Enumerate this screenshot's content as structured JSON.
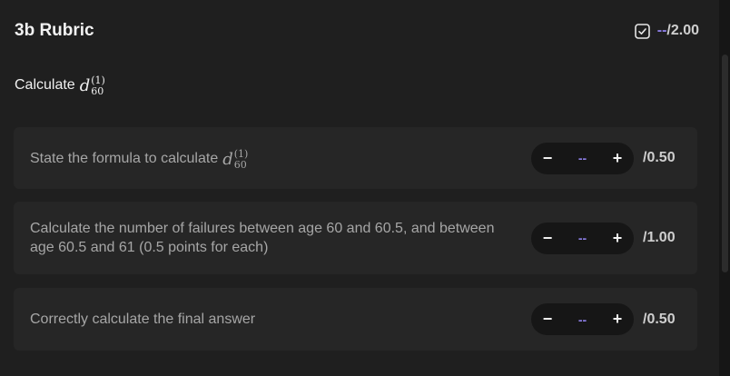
{
  "rubric": {
    "title": "3b Rubric",
    "score_dashes": "--",
    "score_total": "/2.00",
    "question_label": "Calculate",
    "question_math": {
      "var": "d",
      "sup": "(1)",
      "sub": "60"
    }
  },
  "items": [
    {
      "text": "State the formula to calculate",
      "math": {
        "var": "d",
        "sup": "(1)",
        "sub": "60"
      },
      "minus": "−",
      "value": "--",
      "plus": "+",
      "max": "/0.50"
    },
    {
      "text": "Calculate the number of failures between age 60 and 60.5, and between age 60.5 and 61 (0.5 points for each)",
      "minus": "−",
      "value": "--",
      "plus": "+",
      "max": "/1.00"
    },
    {
      "text": "Correctly calculate the final answer",
      "minus": "−",
      "value": "--",
      "plus": "+",
      "max": "/0.50"
    }
  ],
  "colors": {
    "accent": "#8c7ee6",
    "background": "#1f1f1f",
    "card": "#262626"
  }
}
